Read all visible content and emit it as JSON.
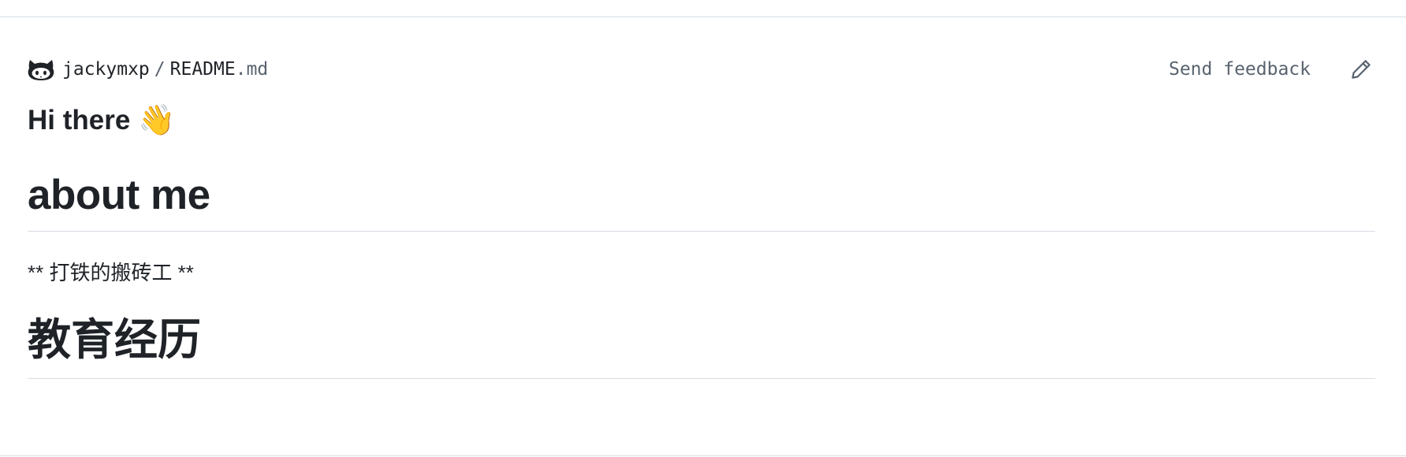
{
  "header": {
    "owner": "jackymxp",
    "separator": "/",
    "file_name": "README",
    "file_ext": ".md",
    "feedback_label": "Send feedback"
  },
  "content": {
    "greeting": "Hi there",
    "greeting_emoji": "👋",
    "heading_about": "about me",
    "about_text": "** 打铁的搬砖工 **",
    "heading_education": "教育经历"
  },
  "icons": {
    "logo": "octocat-icon",
    "edit": "pencil-icon"
  }
}
